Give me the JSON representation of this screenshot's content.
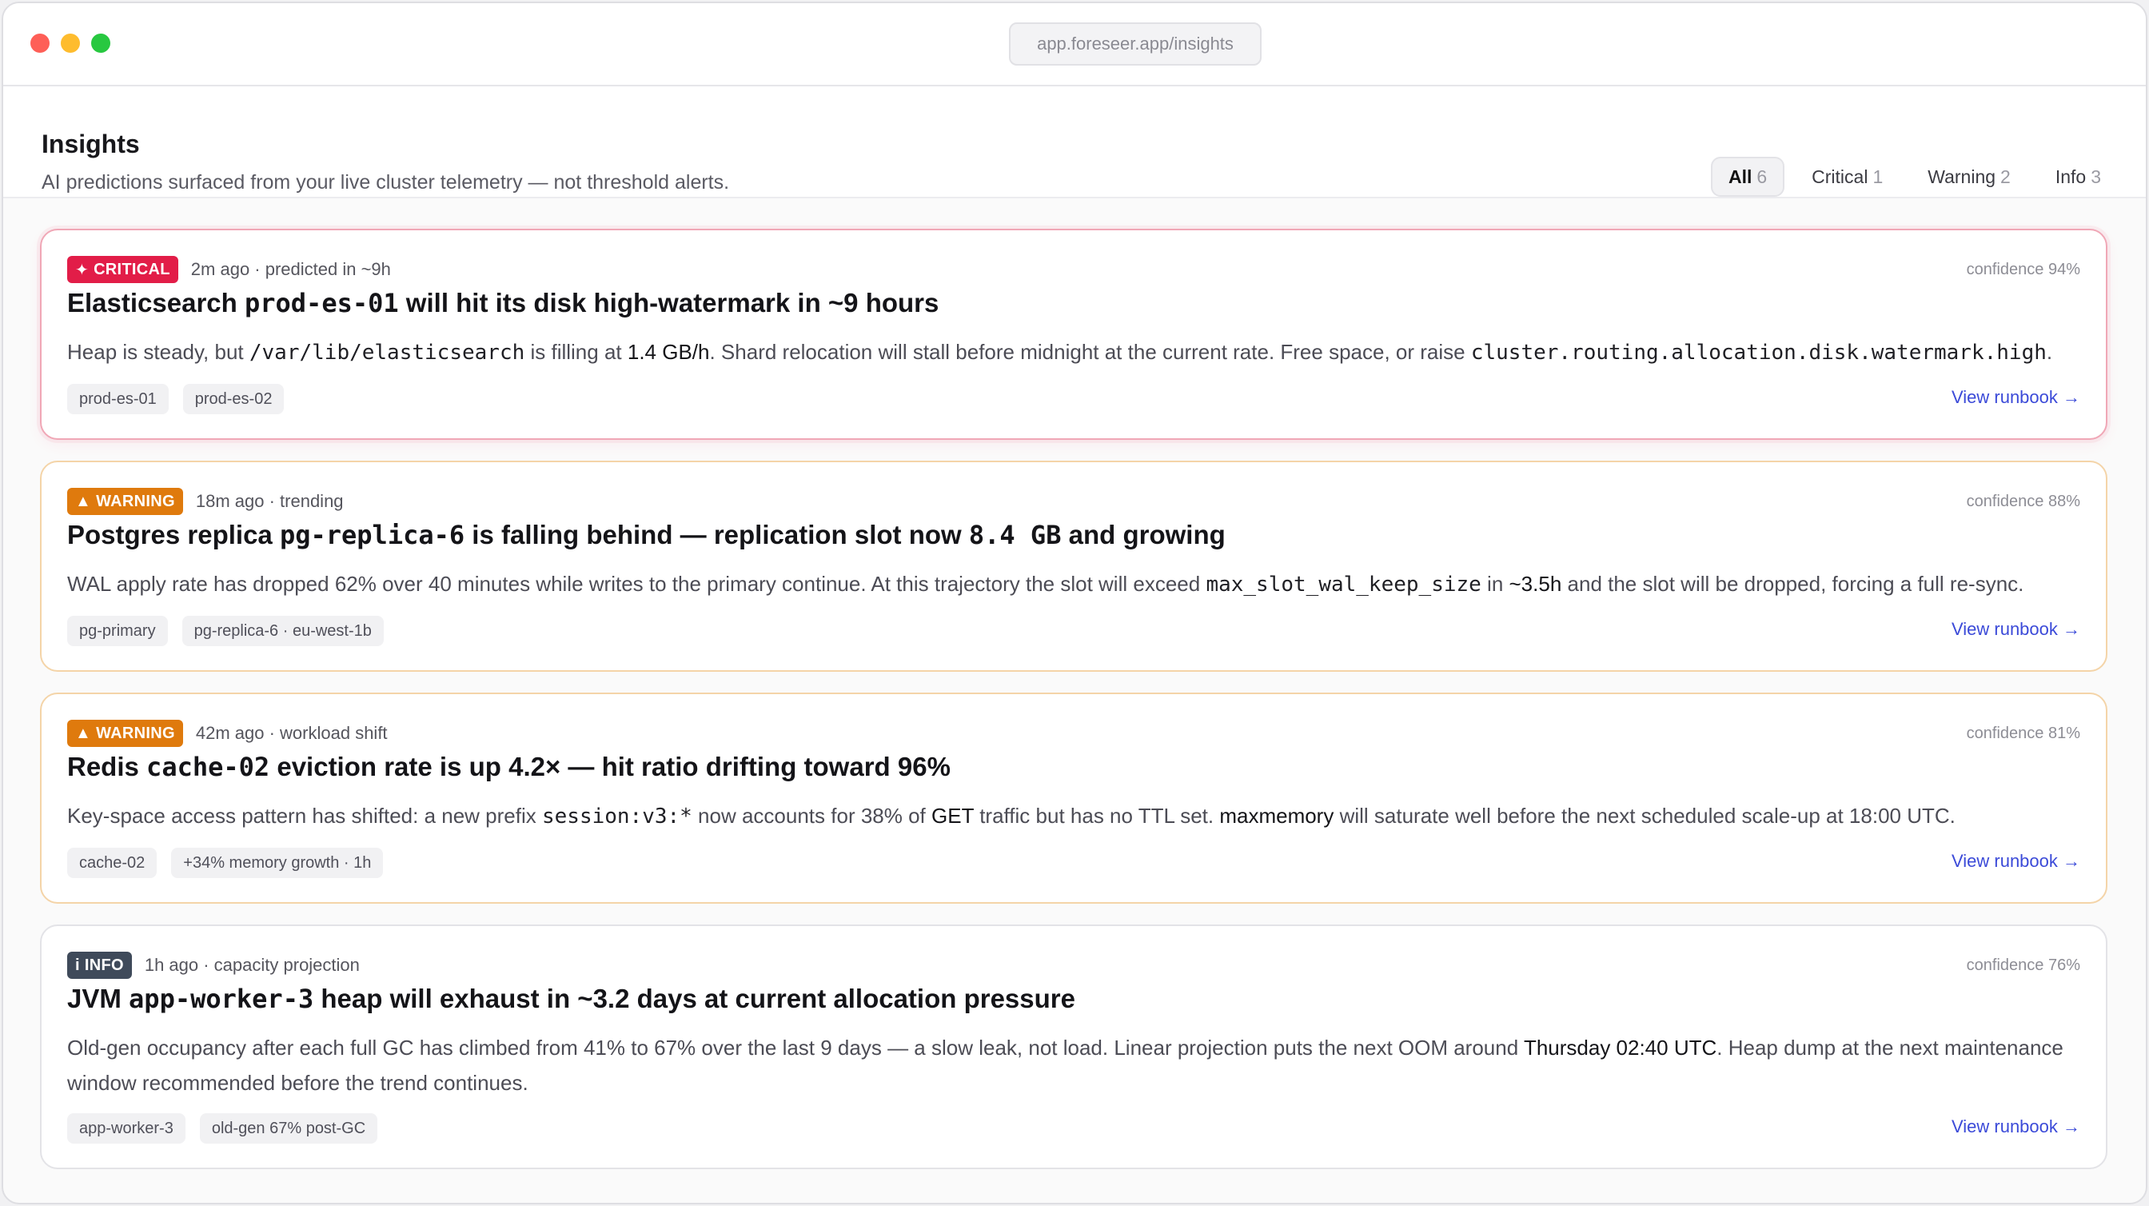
{
  "browser": {
    "url": "app.foreseer.app/insights"
  },
  "header": {
    "title": "Insights",
    "subtitle": "AI predictions surfaced from your live cluster telemetry — not threshold alerts."
  },
  "filters": [
    {
      "label": "All",
      "count": "6"
    },
    {
      "label": "Critical",
      "count": "1"
    },
    {
      "label": "Warning",
      "count": "2"
    },
    {
      "label": "Info",
      "count": "3"
    }
  ],
  "cards": [
    {
      "badge": "CRITICAL",
      "badge_icon": "✦",
      "meta": "2m ago · predicted in ~9h",
      "confidence": "confidence 94%",
      "title": [
        "Elasticsearch ",
        "prod-es-01",
        " will hit its disk high-watermark in ~9 hours"
      ],
      "body": [
        "Heap is steady, but ",
        "/var/lib/elasticsearch",
        " is filling at ",
        "1.4 GB/h",
        ". Shard relocation will stall before midnight at the current rate. Free space, or raise ",
        "cluster.routing.allocation.disk.watermark.high",
        "."
      ],
      "tags": [
        "prod-es-01",
        "prod-es-02"
      ],
      "runbook": "View runbook →"
    },
    {
      "badge": "WARNING",
      "badge_icon": "▲",
      "meta": "18m ago · trending",
      "confidence": "confidence 88%",
      "title": [
        "Postgres replica ",
        "pg-replica-6",
        " is falling behind — replication slot now ",
        "8.4 GB",
        " and growing"
      ],
      "body": [
        "WAL apply rate has dropped 62% over 40 minutes while writes to the primary continue. At this trajectory the slot will exceed ",
        "max_slot_wal_keep_size",
        " in ",
        "~3.5h",
        " and the slot will be dropped, forcing a full re-sync."
      ],
      "tags": [
        "pg-primary",
        "pg-replica-6 · eu-west-1b"
      ],
      "runbook": "View runbook →"
    },
    {
      "badge": "WARNING",
      "badge_icon": "▲",
      "meta": "42m ago · workload shift",
      "confidence": "confidence 81%",
      "title": [
        "Redis ",
        "cache-02",
        " eviction rate is up 4.2× — hit ratio drifting toward 96%"
      ],
      "body": [
        "Key-space access pattern has shifted: a new prefix ",
        "session:v3:*",
        " now accounts for 38% of ",
        "GET",
        " traffic but has no TTL set. ",
        "maxmemory",
        " will saturate well before the next scheduled scale-up at 18:00 UTC."
      ],
      "tags": [
        "cache-02",
        "+34% memory growth · 1h"
      ],
      "runbook": "View runbook →"
    },
    {
      "badge": "INFO",
      "badge_icon": "i",
      "meta": "1h ago · capacity projection",
      "confidence": "confidence 76%",
      "title": [
        "JVM ",
        "app-worker-3",
        " heap will exhaust in ~3.2 days at current allocation pressure"
      ],
      "body": [
        "Old-gen occupancy after each full GC has climbed from 41% to 67% over the last 9 days — a slow leak, not load. Linear projection puts the next OOM around ",
        "Thursday 02:40 UTC",
        ". Heap dump at the next maintenance window recommended before the trend continues."
      ],
      "tags": [
        "app-worker-3",
        "old-gen 67% post-GC"
      ],
      "runbook": "View runbook →"
    }
  ]
}
